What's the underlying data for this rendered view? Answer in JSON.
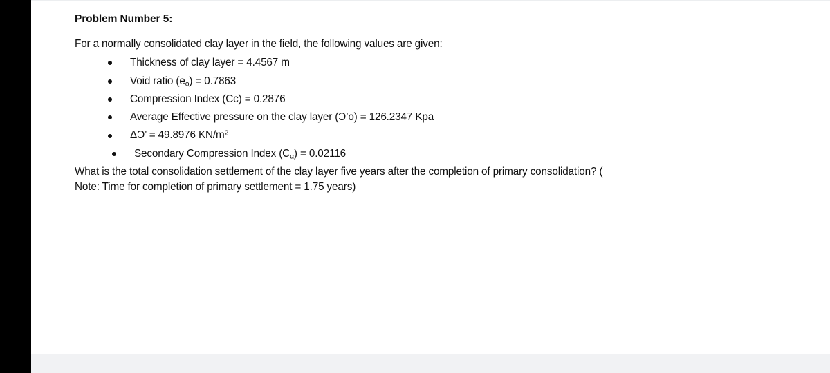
{
  "document": {
    "title": "Problem Number 5:",
    "intro": "For a normally consolidated clay layer in the field, the following values are given:",
    "bullets": [
      {
        "text": "Thickness of clay layer = 4.4567  m"
      },
      {
        "label_pre": "Void ratio (e",
        "sub": "o",
        "label_post": ") = 0.7863"
      },
      {
        "text": "Compression Index (Cc) = 0.2876"
      },
      {
        "label_pre": "Average Effective pressure on the clay layer (Ɔ’o) = 126.2347  Kpa"
      },
      {
        "label_pre": "ΔƆ’ = 49.8976 KN/m",
        "sup": "2"
      },
      {
        "label_pre": "Secondary Compression Index (C",
        "sub": "α",
        "label_post": ") = 0.02116"
      }
    ],
    "question_line_1": "What is the total consolidation settlement of the clay layer five years after the completion of primary consolidation? (",
    "question_line_2": "Note: Time for completion of primary settlement = 1.75 years)"
  }
}
